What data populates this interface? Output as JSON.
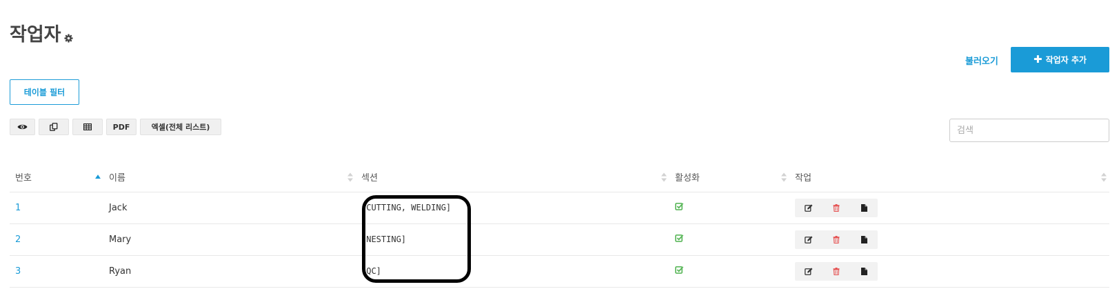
{
  "page": {
    "title": "작업자"
  },
  "header": {
    "import_label": "불러오기",
    "add_label": "작업자 추가"
  },
  "filter": {
    "label": "테이블 필터"
  },
  "export": {
    "pdf_label": "PDF",
    "excel_label": "엑셀(전체 리스트)"
  },
  "search": {
    "placeholder": "검색",
    "value": ""
  },
  "table": {
    "columns": [
      "번호",
      "이름",
      "섹션",
      "활성화",
      "작업"
    ],
    "sort_column": "번호",
    "rows": [
      {
        "id": "1",
        "name": "Jack",
        "section": "[CUTTING, WELDING]",
        "active": true
      },
      {
        "id": "2",
        "name": "Mary",
        "section": "[NESTING]",
        "active": true
      },
      {
        "id": "3",
        "name": "Ryan",
        "section": "[QC]",
        "active": true
      }
    ]
  },
  "colors": {
    "accent": "#1a9bd7",
    "check": "#5cb85c",
    "delete": "#e55353",
    "highlight": "#000000"
  },
  "icons": {
    "title": "gear-icon",
    "add": "plus-icon",
    "export": [
      "eye-icon",
      "copy-icon",
      "table-icon"
    ],
    "row_actions": [
      "edit-icon",
      "delete-icon",
      "document-icon"
    ],
    "active": "check-square-icon"
  }
}
